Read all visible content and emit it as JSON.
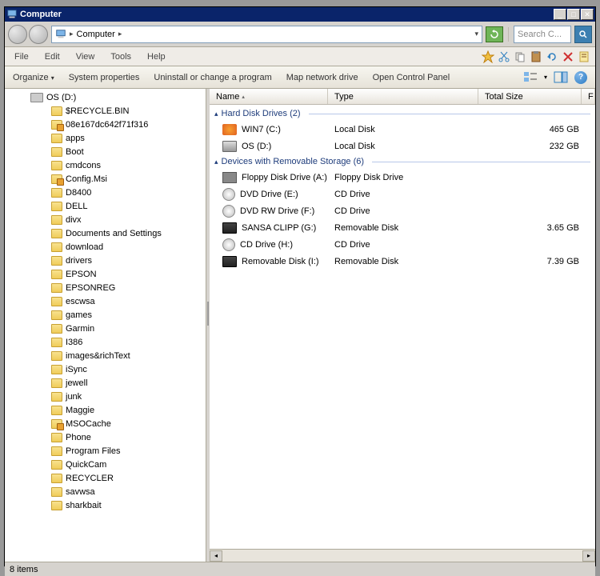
{
  "title": "Computer",
  "address": {
    "label": "Computer"
  },
  "search": {
    "placeholder": "Search C..."
  },
  "menus": [
    "File",
    "Edit",
    "View",
    "Tools",
    "Help"
  ],
  "commands": {
    "organize": "Organize",
    "sysprops": "System properties",
    "uninstall": "Uninstall or change a program",
    "mapdrive": "Map network drive",
    "controlpanel": "Open Control Panel"
  },
  "tree": {
    "root": "OS (D:)",
    "folders": [
      {
        "n": "$RECYCLE.BIN",
        "lock": false
      },
      {
        "n": "08e167dc642f71f316",
        "lock": true
      },
      {
        "n": "apps",
        "lock": false
      },
      {
        "n": "Boot",
        "lock": false
      },
      {
        "n": "cmdcons",
        "lock": false
      },
      {
        "n": "Config.Msi",
        "lock": true
      },
      {
        "n": "D8400",
        "lock": false
      },
      {
        "n": "DELL",
        "lock": false
      },
      {
        "n": "divx",
        "lock": false
      },
      {
        "n": "Documents and Settings",
        "lock": false
      },
      {
        "n": "download",
        "lock": false
      },
      {
        "n": "drivers",
        "lock": false
      },
      {
        "n": "EPSON",
        "lock": false
      },
      {
        "n": "EPSONREG",
        "lock": false
      },
      {
        "n": "escwsa",
        "lock": false
      },
      {
        "n": "games",
        "lock": false
      },
      {
        "n": "Garmin",
        "lock": false
      },
      {
        "n": "I386",
        "lock": false
      },
      {
        "n": "images&richText",
        "lock": false
      },
      {
        "n": "iSync",
        "lock": false
      },
      {
        "n": "jewell",
        "lock": false
      },
      {
        "n": "junk",
        "lock": false
      },
      {
        "n": "Maggie",
        "lock": false
      },
      {
        "n": "MSOCache",
        "lock": true
      },
      {
        "n": "Phone",
        "lock": false
      },
      {
        "n": "Program Files",
        "lock": false
      },
      {
        "n": "QuickCam",
        "lock": false
      },
      {
        "n": "RECYCLER",
        "lock": false
      },
      {
        "n": "savwsa",
        "lock": false
      },
      {
        "n": "sharkbait",
        "lock": false
      }
    ]
  },
  "columns": {
    "name": "Name",
    "type": "Type",
    "size": "Total Size",
    "free": "F"
  },
  "groups": {
    "hdd": {
      "label": "Hard Disk Drives (2)",
      "items": [
        {
          "name": "WIN7 (C:)",
          "type": "Local Disk",
          "size": "465 GB",
          "icon": "win"
        },
        {
          "name": "OS (D:)",
          "type": "Local Disk",
          "size": "232 GB",
          "icon": "hdd"
        }
      ]
    },
    "rem": {
      "label": "Devices with Removable Storage (6)",
      "items": [
        {
          "name": "Floppy Disk Drive (A:)",
          "type": "Floppy Disk Drive",
          "size": "",
          "icon": "fdd"
        },
        {
          "name": "DVD Drive (E:)",
          "type": "CD Drive",
          "size": "",
          "icon": "cd"
        },
        {
          "name": "DVD RW Drive (F:)",
          "type": "CD Drive",
          "size": "",
          "icon": "cd"
        },
        {
          "name": "SANSA CLIPP (G:)",
          "type": "Removable Disk",
          "size": "3.65 GB",
          "icon": "usb"
        },
        {
          "name": "CD Drive (H:)",
          "type": "CD Drive",
          "size": "",
          "icon": "cd"
        },
        {
          "name": "Removable Disk (I:)",
          "type": "Removable Disk",
          "size": "7.39 GB",
          "icon": "usb"
        }
      ]
    }
  },
  "status": "8 items"
}
